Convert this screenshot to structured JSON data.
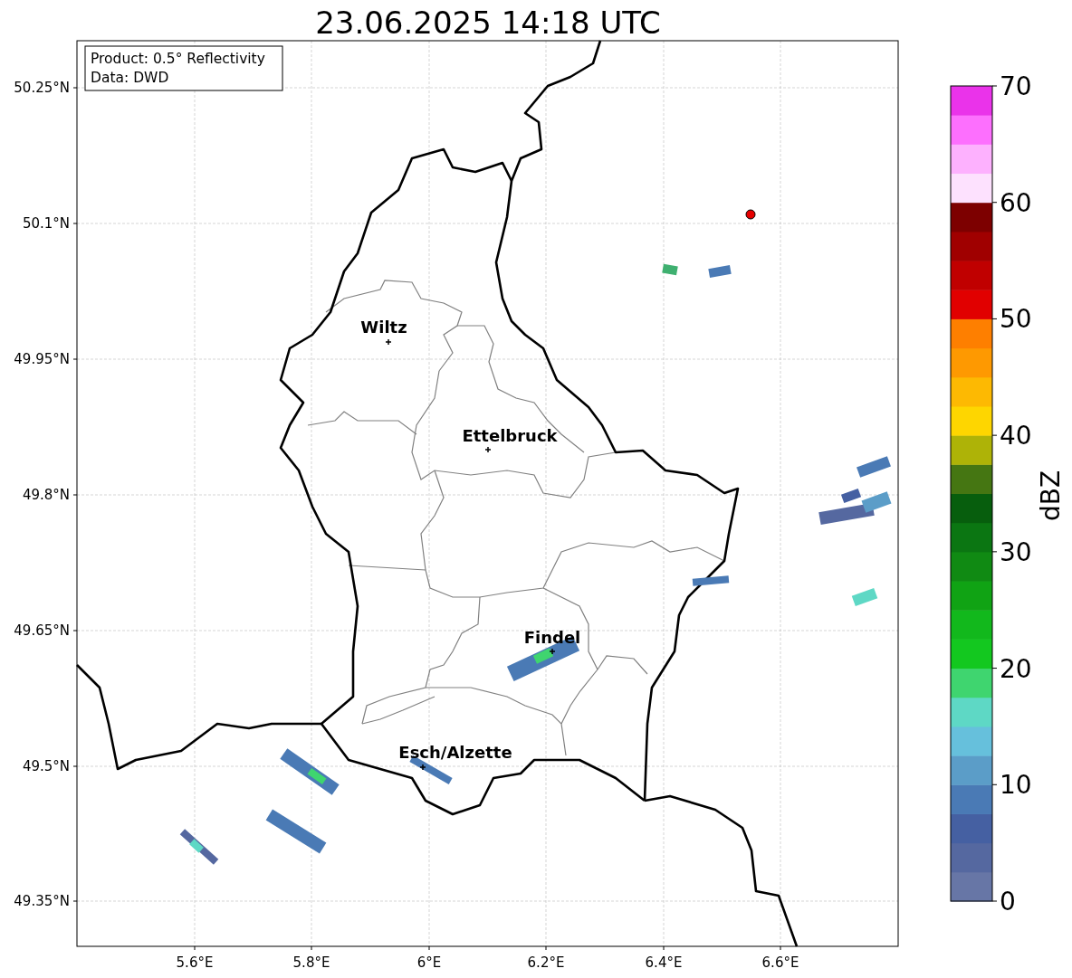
{
  "title": "23.06.2025 14:18 UTC",
  "info_box": [
    "Product: 0.5° Reflectivity",
    "Data: DWD"
  ],
  "y_ticks": [
    "50.25°N",
    "50.1°N",
    "49.95°N",
    "49.8°N",
    "49.65°N",
    "49.5°N",
    "49.35°N"
  ],
  "x_ticks": [
    "5.6°E",
    "5.8°E",
    "6°E",
    "6.2°E",
    "6.4°E",
    "6.6°E"
  ],
  "cities": [
    {
      "name": "Wiltz"
    },
    {
      "name": "Ettelbruck"
    },
    {
      "name": "Findel"
    },
    {
      "name": "Esch/Alzette"
    }
  ],
  "colorbar": {
    "label": "dBZ",
    "ticks": [
      "70",
      "60",
      "50",
      "40",
      "30",
      "20",
      "10",
      "0"
    ],
    "levels": [
      {
        "color": "#6776a6"
      },
      {
        "color": "#5568a0"
      },
      {
        "color": "#4560a2"
      },
      {
        "color": "#4a7ab5"
      },
      {
        "color": "#5b9dc8"
      },
      {
        "color": "#66c0dc"
      },
      {
        "color": "#5ed8c5"
      },
      {
        "color": "#3fd56f"
      },
      {
        "color": "#13c81f"
      },
      {
        "color": "#12b81c"
      },
      {
        "color": "#10a314"
      },
      {
        "color": "#108a13"
      },
      {
        "color": "#0b7612"
      },
      {
        "color": "#075e0d"
      },
      {
        "color": "#457612"
      },
      {
        "color": "#aeb307"
      },
      {
        "color": "#fed600"
      },
      {
        "color": "#fdb902"
      },
      {
        "color": "#fe9901"
      },
      {
        "color": "#fe7f00"
      },
      {
        "color": "#e10000"
      },
      {
        "color": "#c00000"
      },
      {
        "color": "#a00000"
      },
      {
        "color": "#7d0000"
      },
      {
        "color": "#fde1fe"
      },
      {
        "color": "#fdb1fe"
      },
      {
        "color": "#fd6ffe"
      },
      {
        "color": "#ea33ea"
      }
    ]
  }
}
